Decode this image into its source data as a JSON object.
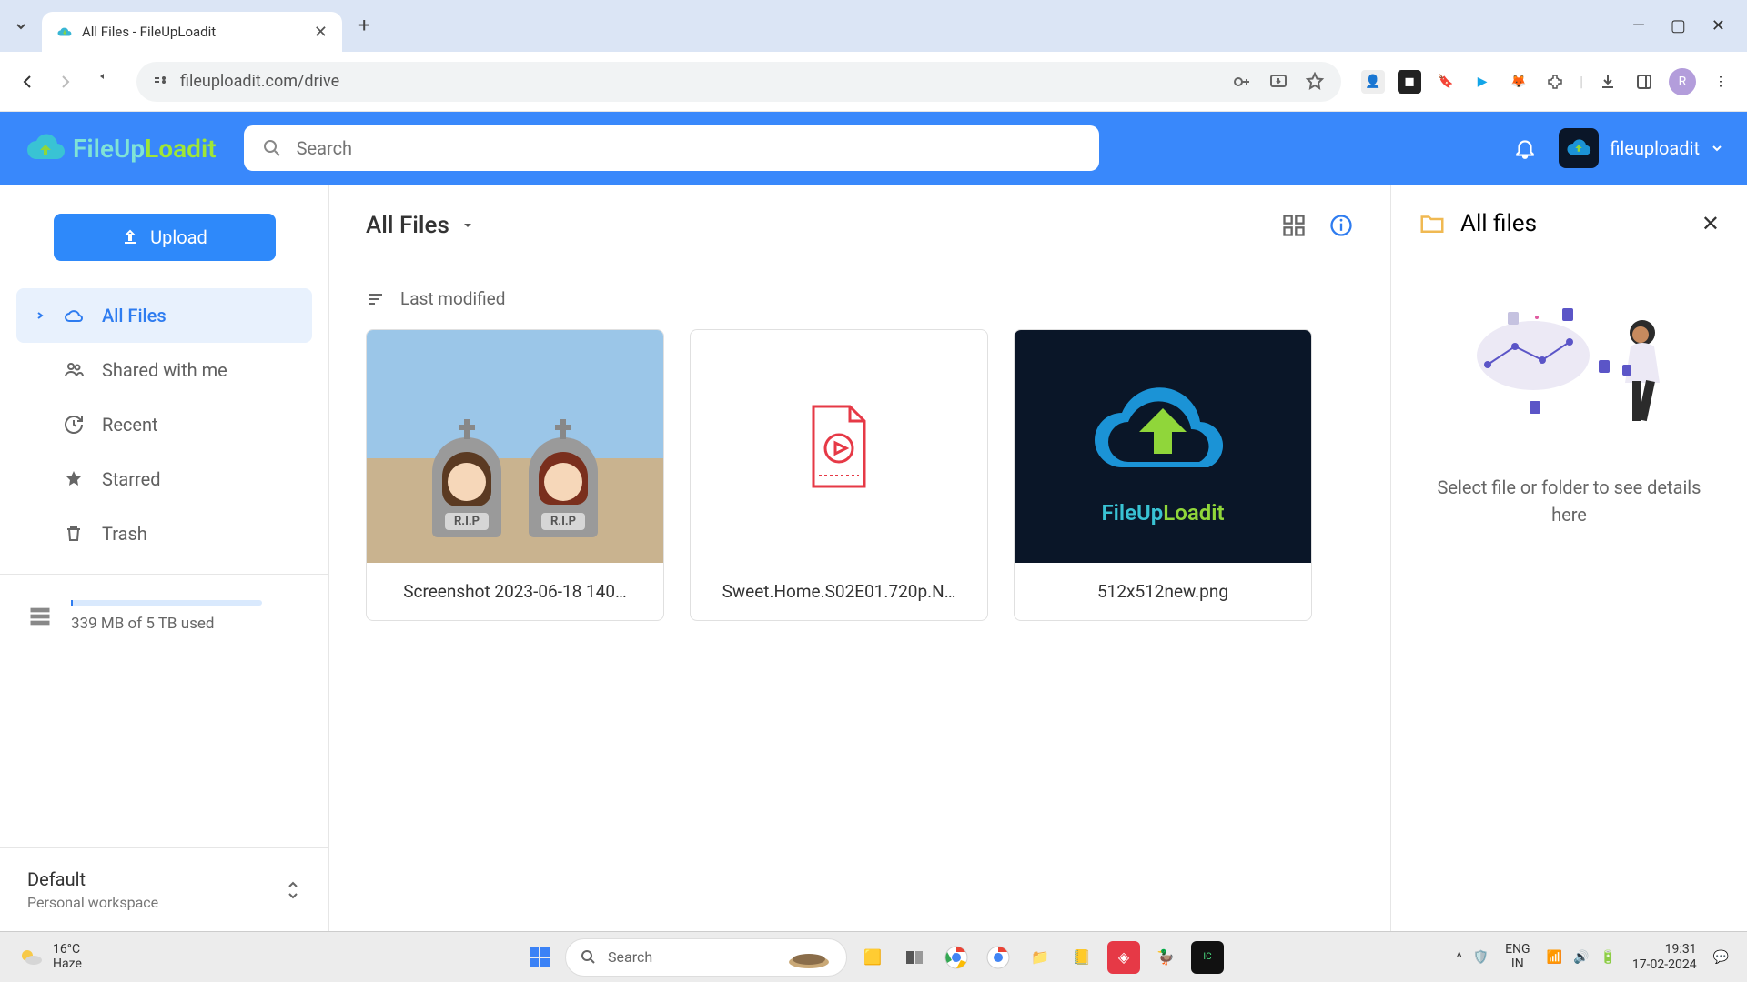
{
  "browser": {
    "tab_title": "All Files - FileUpLoadit",
    "url": "fileuploadit.com/drive"
  },
  "header": {
    "search_placeholder": "Search",
    "username": "fileuploadit",
    "logo_p1": "FileUp",
    "logo_p2": "Loadit"
  },
  "sidebar": {
    "upload": "Upload",
    "items": [
      {
        "label": "All Files"
      },
      {
        "label": "Shared with me"
      },
      {
        "label": "Recent"
      },
      {
        "label": "Starred"
      },
      {
        "label": "Trash"
      }
    ],
    "storage_text": "339 MB of 5 TB used",
    "workspace_title": "Default",
    "workspace_sub": "Personal workspace"
  },
  "content": {
    "breadcrumb": "All Files",
    "sort_label": "Last modified",
    "files": [
      {
        "name": "Screenshot 2023-06-18 140…"
      },
      {
        "name": "Sweet.Home.S02E01.720p.N…"
      },
      {
        "name": "512x512new.png"
      }
    ],
    "thumb3_p1": "FileUp",
    "thumb3_p2": "Loadit",
    "rip": "R.I.P"
  },
  "details": {
    "title": "All files",
    "hint": "Select file or folder to see details here"
  },
  "taskbar": {
    "temp": "16°C",
    "cond": "Haze",
    "search": "Search",
    "lang1": "ENG",
    "lang2": "IN",
    "time": "19:31",
    "date": "17-02-2024"
  }
}
